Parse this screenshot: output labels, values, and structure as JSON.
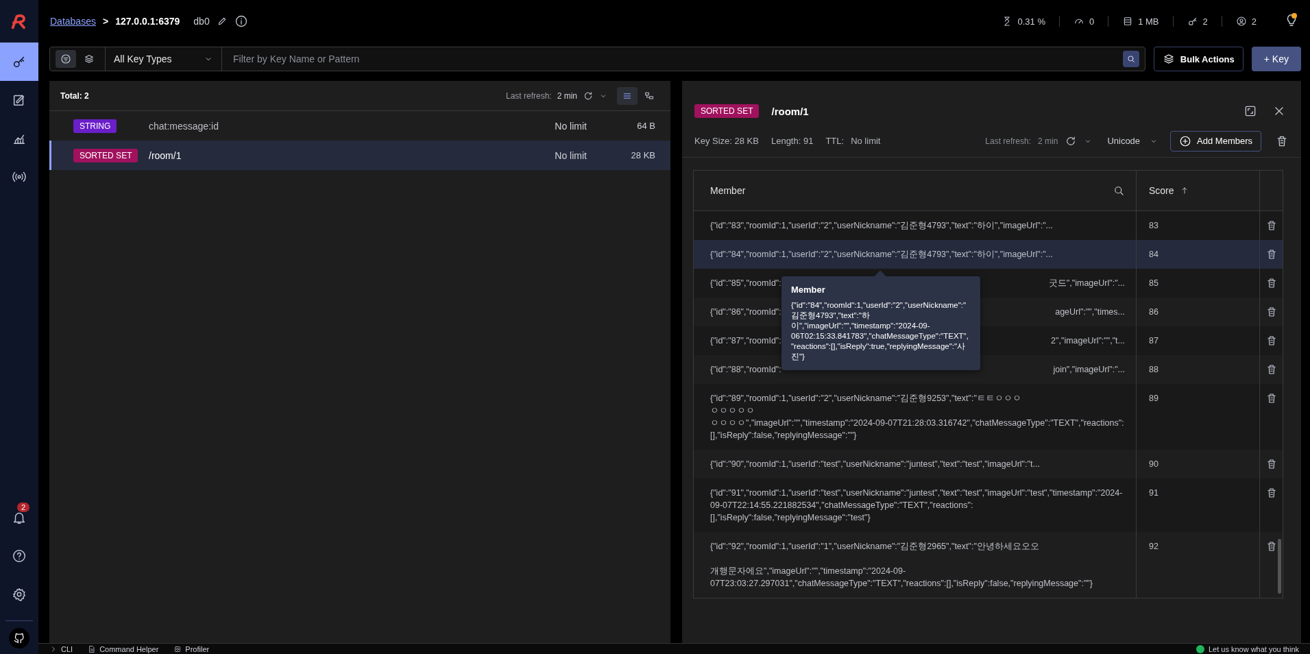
{
  "breadcrumb": {
    "link": "Databases",
    "separator": ">",
    "host": "127.0.0.1:6379",
    "db": "db0"
  },
  "stats": [
    {
      "kind": "cpu",
      "value": "0.31 %"
    },
    {
      "kind": "ops",
      "value": "0"
    },
    {
      "kind": "memory",
      "value": "1 MB"
    },
    {
      "kind": "keys",
      "value": "2"
    },
    {
      "kind": "clients",
      "value": "2"
    }
  ],
  "sidebar": {
    "items": [
      {
        "kind": "browser",
        "selected": true
      },
      {
        "kind": "workbench",
        "selected": false
      },
      {
        "kind": "analytics",
        "selected": false
      },
      {
        "kind": "pubsub",
        "selected": false
      }
    ],
    "notification_badge": "2"
  },
  "filter": {
    "key_type": "All Key Types",
    "placeholder": "Filter by Key Name or Pattern"
  },
  "buttons": {
    "bulk": "Bulk Actions",
    "add": "+ Key"
  },
  "key_list": {
    "total": "Total: 2",
    "refresh_label": "Last refresh:",
    "refresh_value": "2 min",
    "views": [
      {
        "kind": "list",
        "selected": true
      },
      {
        "kind": "tree",
        "selected": false
      }
    ],
    "keys": [
      {
        "type": "STRING",
        "color": "#6a1fc9",
        "name": "chat:message:id",
        "ttl": "No limit",
        "size": "64 B",
        "selected": false
      },
      {
        "type": "SORTED SET",
        "color": "#a0125e",
        "name": "/room/1",
        "ttl": "No limit",
        "size": "28 KB",
        "selected": true
      }
    ]
  },
  "detail": {
    "type": "SORTED SET",
    "color": "#a0125e",
    "key": "/room/1",
    "key_size": "Key Size: 28 KB",
    "length": "Length: 91",
    "ttl_label": "TTL:",
    "ttl": "No limit",
    "refresh_label": "Last refresh:",
    "refresh_value": "2 min",
    "encoding": "Unicode",
    "add_button": "Add Members",
    "table": {
      "columns": [
        "Member",
        "Score"
      ],
      "sort_ascending": true,
      "rows": [
        {
          "member": "{\"id\":\"83\",\"roomId\":1,\"userId\":\"2\",\"userNickname\":\"김준형4793\",\"text\":\"하이\",\"imageUrl\":\"...",
          "score": "83",
          "selected": false
        },
        {
          "member": "{\"id\":\"84\",\"roomId\":1,\"userId\":\"2\",\"userNickname\":\"김준형4793\",\"text\":\"하이\",\"imageUrl\":\"...",
          "score": "84",
          "selected": true
        },
        {
          "member_start": "{\"id\":\"85\",\"roomId\":",
          "member_end": "굿드\",\"imageUrl\":\"...",
          "score": "85",
          "selected": false
        },
        {
          "member_start": "{\"id\":\"86\",\"roomId\":",
          "member_end": "ageUrl\":\"\",\"times...",
          "score": "86",
          "selected": false
        },
        {
          "member_start": "{\"id\":\"87\",\"roomId\":",
          "member_end": "2\",\"imageUrl\":\"\",\"t...",
          "score": "87",
          "selected": false
        },
        {
          "member_start": "{\"id\":\"88\",\"roomId\":",
          "member_end": "join\",\"imageUrl\":\"...",
          "score": "88",
          "selected": false
        },
        {
          "member_lines": [
            "{\"id\":\"89\",\"roomId\":1,\"userId\":\"2\",\"userNickname\":\"김준형9253\",\"text\":\"ㅌㅌㅇㅇㅇ",
            "ㅇㅇㅇㅇㅇ",
            "ㅇㅇㅇㅇ\",\"imageUrl\":\"\",\"timestamp\":\"2024-09-07T21:28:03.316742\",\"chatMessageType\":\"TEXT\",\"reactions\":[],\"isReply\":false,\"replyingMessage\":\"\"}"
          ],
          "score": "89",
          "selected": false
        },
        {
          "member": "{\"id\":\"90\",\"roomId\":1,\"userId\":\"test\",\"userNickname\":\"juntest\",\"text\":\"test\",\"imageUrl\":\"t...",
          "score": "90",
          "selected": false
        },
        {
          "member": "{\"id\":\"91\",\"roomId\":1,\"userId\":\"test\",\"userNickname\":\"juntest\",\"text\":\"test\",\"imageUrl\":\"test\",\"timestamp\":\"2024-09-07T22:14:55.221882534\",\"chatMessageType\":\"TEXT\",\"reactions\":[],\"isReply\":false,\"replyingMessage\":\"test\"}",
          "score": "91",
          "selected": false
        },
        {
          "member": "{\"id\":\"92\",\"roomId\":1,\"userId\":\"1\",\"userNickname\":\"김준형2965\",\"text\":\"안녕하세요오오\n\n개행문자에요\",\"imageUrl\":\"\",\"timestamp\":\"2024-09-07T23:03:27.297031\",\"chatMessageType\":\"TEXT\",\"reactions\":[],\"isReply\":false,\"replyingMessage\":\"\"}",
          "score": "92",
          "selected": false
        }
      ]
    },
    "tooltip": {
      "title": "Member",
      "text": "{\"id\":\"84\",\"roomId\":1,\"userId\":\"2\",\"userNickname\":\"김준형4793\",\"text\":\"하이\",\"imageUrl\":\"\",\"timestamp\":\"2024-09-06T02:15:33.841783\",\"chatMessageType\":\"TEXT\",\"reactions\":[],\"isReply\":true,\"replyingMessage\":\"사진\"}"
    }
  },
  "bottom_bar": {
    "items": [
      {
        "kind": "cli",
        "label": "CLI"
      },
      {
        "kind": "helper",
        "label": "Command Helper"
      },
      {
        "kind": "profiler",
        "label": "Profiler"
      }
    ],
    "feedback": "Let us know what you think"
  }
}
